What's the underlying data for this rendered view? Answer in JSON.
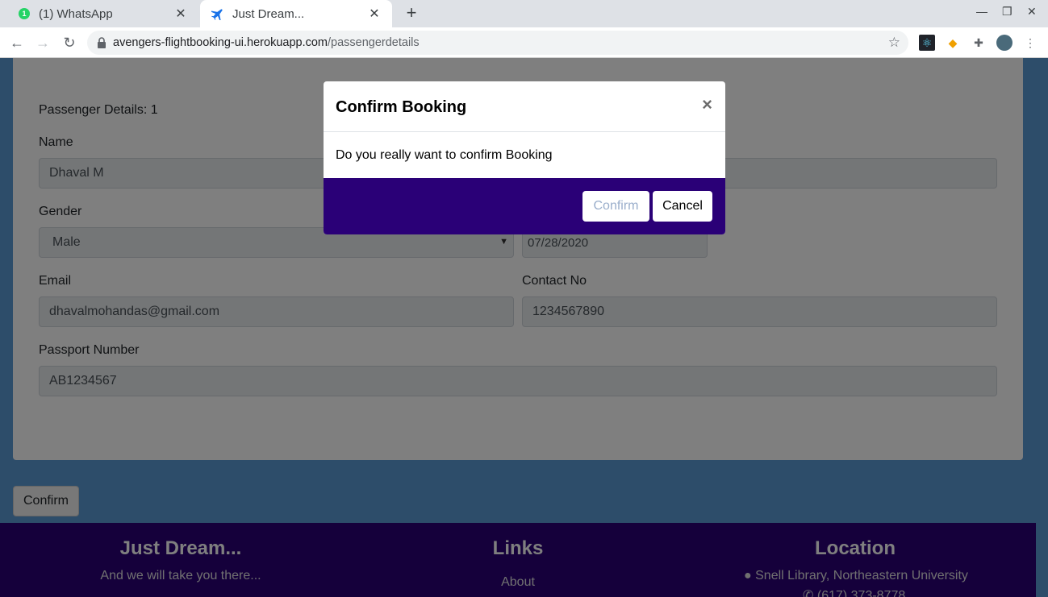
{
  "browser": {
    "tabs": [
      {
        "title": "(1) WhatsApp",
        "icon": "whatsapp-icon",
        "badge": "1"
      },
      {
        "title": "Just Dream...",
        "icon": "airplane-icon"
      }
    ],
    "new_tab": "+",
    "url_host": "avengers-flightbooking-ui.herokuapp.com",
    "url_path": "/passengerdetails"
  },
  "form": {
    "heading": "Passenger Details: 1",
    "name_label": "Name",
    "name_value": "Dhaval M",
    "gender_label": "Gender",
    "gender_value": "Male",
    "dob_value": "07/28/2020",
    "email_label": "Email",
    "email_value": "dhavalmohandas@gmail.com",
    "contact_label": "Contact No",
    "contact_value": "1234567890",
    "passport_label": "Passport Number",
    "passport_value": "AB1234567"
  },
  "page_confirm_label": "Confirm",
  "footer": {
    "brand_title": "Just Dream...",
    "brand_tagline": "And we will take you there...",
    "links_title": "Links",
    "links": [
      "About"
    ],
    "location_title": "Location",
    "address": "Snell Library, Northeastern University",
    "phone": "(617) 373-8778"
  },
  "modal": {
    "title": "Confirm Booking",
    "close": "×",
    "body": "Do you really want to confirm Booking",
    "confirm_label": "Confirm",
    "cancel_label": "Cancel"
  },
  "colors": {
    "page_bg": "#5b9bd5",
    "footer_bg": "#2a0077",
    "modal_footer_bg": "#2a0077"
  }
}
